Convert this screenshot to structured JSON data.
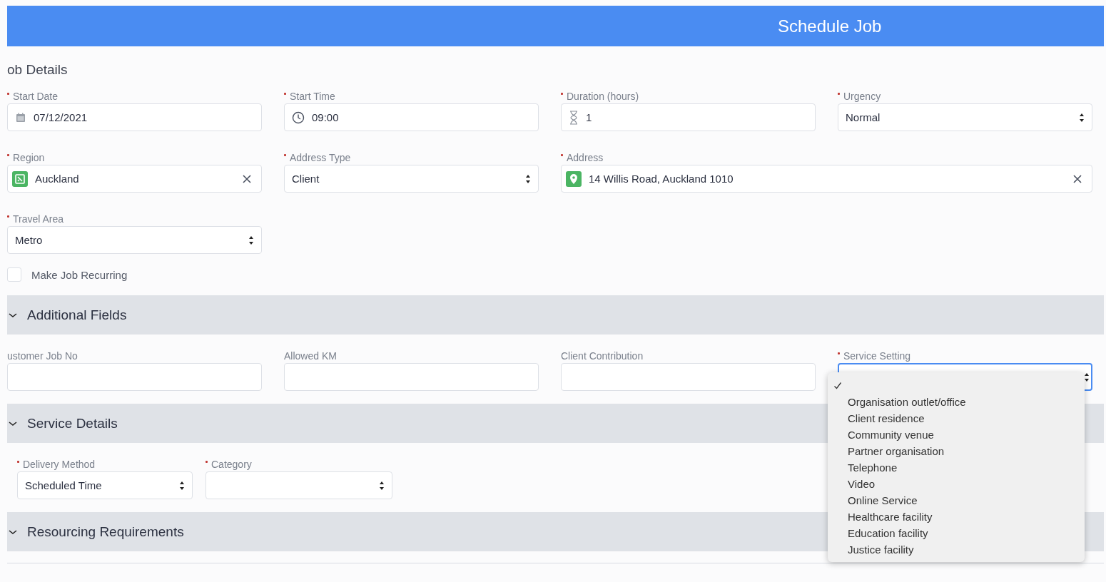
{
  "header": {
    "title": "Schedule Job"
  },
  "job_details": {
    "title": "ob Details",
    "fields": [
      {
        "kind": "date",
        "label": "Start Date",
        "required": true,
        "value": "07/12/2021"
      },
      {
        "kind": "time",
        "label": "Start Time",
        "required": true,
        "value": "09:00"
      },
      {
        "kind": "duration",
        "label": "Duration (hours)",
        "required": true,
        "value": "1"
      },
      {
        "kind": "select",
        "label": "Urgency",
        "required": true,
        "value": "Normal"
      },
      {
        "kind": "region-lookup",
        "label": "Region",
        "required": true,
        "value": "Auckland"
      },
      {
        "kind": "select",
        "label": "Address Type",
        "required": true,
        "value": "Client"
      },
      {
        "kind": "address-lookup",
        "label": "Address",
        "required": true,
        "value": "14 Willis Road, Auckland 1010"
      },
      {
        "kind": "select",
        "label": "Travel Area",
        "required": true,
        "value": "Metro"
      }
    ],
    "recurring": {
      "label": "Make Job Recurring",
      "checked": false
    }
  },
  "sections": [
    {
      "title": "Additional Fields",
      "expanded": true,
      "fields": [
        {
          "kind": "text",
          "label": "ustomer Job No",
          "required": false
        },
        {
          "kind": "text",
          "label": "Allowed KM",
          "required": false
        },
        {
          "kind": "text",
          "label": "Client Contribution",
          "required": false
        },
        {
          "kind": "select",
          "label": "Service Setting",
          "required": true,
          "focused": true
        }
      ]
    },
    {
      "title": "Service Details",
      "expanded": true,
      "fields": [
        {
          "kind": "select",
          "label": "Delivery Method",
          "required": true,
          "value": "Scheduled Time"
        },
        {
          "kind": "select",
          "label": "Category",
          "required": true
        }
      ]
    },
    {
      "title": "Resourcing Requirements",
      "expanded": true
    }
  ],
  "dropdown": {
    "blank_selected": true,
    "options": [
      {
        "label": "Organisation outlet/office",
        "selected": false
      },
      {
        "label": "Client residence",
        "selected": false
      },
      {
        "label": "Community venue",
        "selected": false
      },
      {
        "label": "Partner organisation",
        "selected": false
      },
      {
        "label": "Telephone",
        "selected": false
      },
      {
        "label": "Video",
        "selected": false
      },
      {
        "label": "Online Service",
        "selected": false
      },
      {
        "label": "Healthcare facility",
        "selected": false
      },
      {
        "label": "Education facility",
        "selected": false
      },
      {
        "label": "Justice facility",
        "selected": false
      }
    ]
  }
}
